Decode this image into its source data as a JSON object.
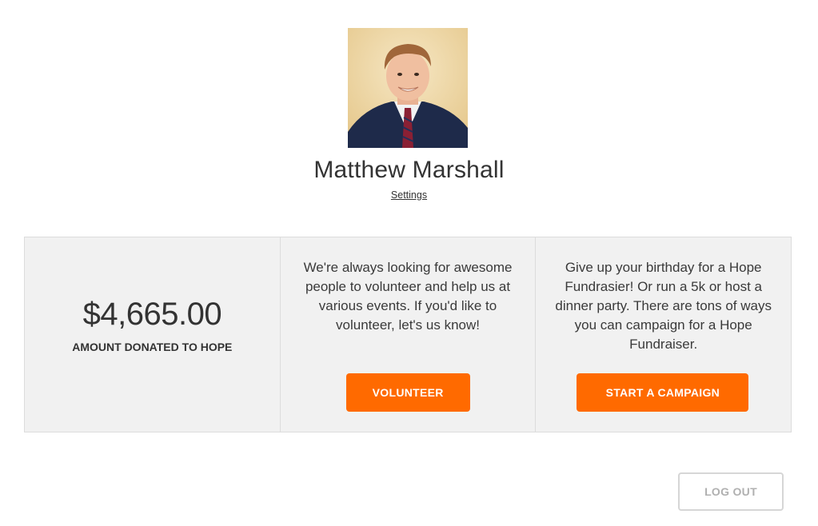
{
  "profile": {
    "name": "Matthew Marshall",
    "settings_label": "Settings"
  },
  "donation": {
    "amount": "$4,665.00",
    "label": "AMOUNT DONATED TO HOPE"
  },
  "volunteer": {
    "text": "We're always looking for awesome people to volunteer and help us at various events. If you'd like to volunteer, let's us know!",
    "button_label": "VOLUNTEER"
  },
  "campaign": {
    "text": "Give up your birthday for a Hope Fundrasier! Or run a 5k or host a dinner party. There are tons of ways you can campaign for a Hope Fundraiser.",
    "button_label": "START A CAMPAIGN"
  },
  "logout_label": "LOG OUT",
  "colors": {
    "accent": "#ff6a00",
    "panel_bg": "#f1f1f1",
    "border": "#dcdcdc"
  },
  "icons": {
    "avatar": "profile-photo"
  }
}
